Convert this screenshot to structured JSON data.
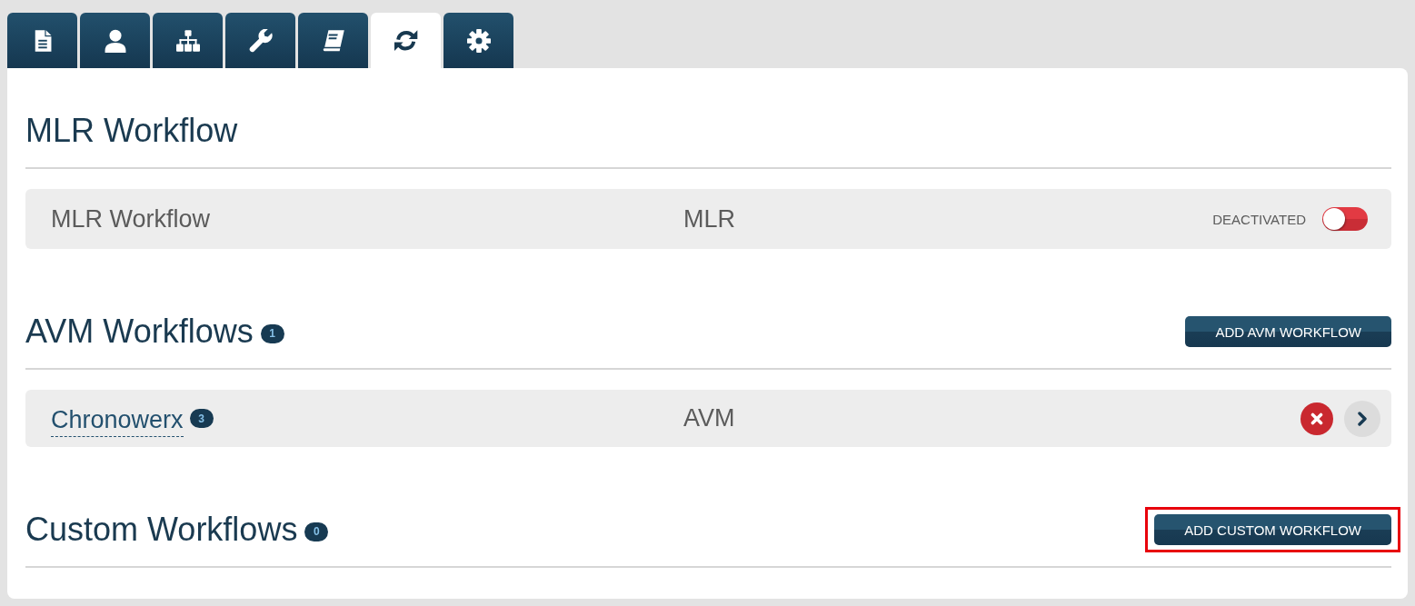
{
  "tabs": [
    {
      "selected": false
    },
    {
      "selected": false
    },
    {
      "selected": false
    },
    {
      "selected": false
    },
    {
      "selected": false
    },
    {
      "selected": true
    },
    {
      "selected": false
    }
  ],
  "sections": [
    {
      "title": "MLR Workflow",
      "workflows": [
        {
          "kind": "toggle",
          "name": "MLR Workflow",
          "type": "MLR",
          "status": "DEACTIVATED",
          "on": false
        }
      ]
    },
    {
      "title": "AVM Workflows",
      "count": "1",
      "button": {
        "label": "ADD AVM WORKFLOW",
        "highlighted": false
      },
      "workflows": [
        {
          "kind": "link",
          "name": "Chronowerx",
          "count": "3",
          "type": "AVM"
        }
      ]
    },
    {
      "title": "Custom Workflows",
      "count": "0",
      "button": {
        "label": "ADD CUSTOM WORKFLOW",
        "highlighted": true
      }
    }
  ]
}
